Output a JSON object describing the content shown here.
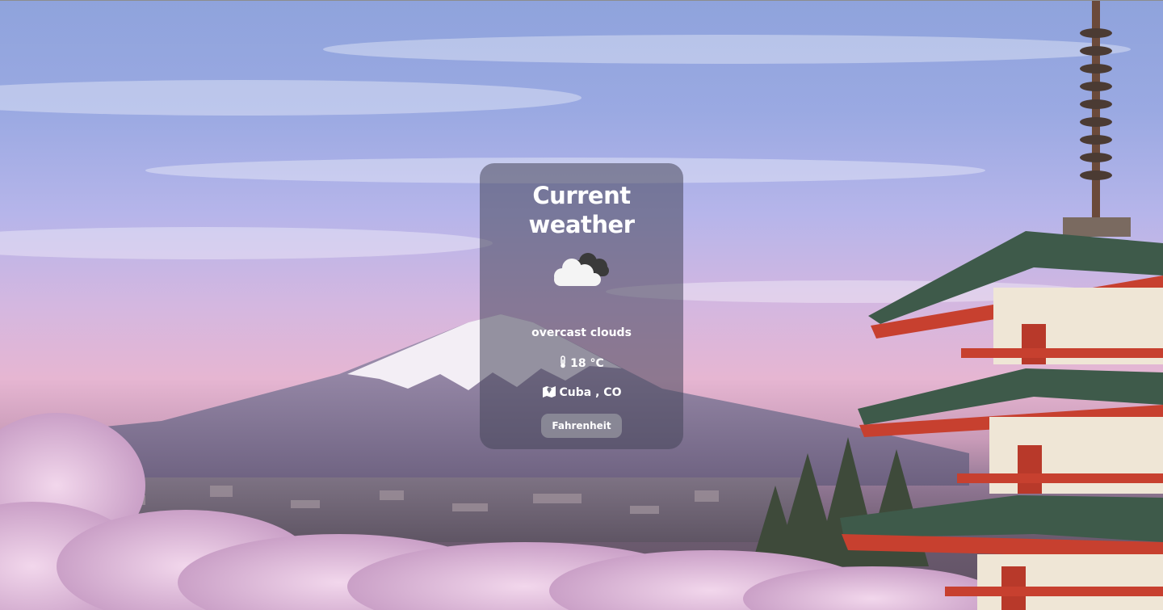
{
  "weather": {
    "title": "Current weather",
    "icon": "cloud-icon",
    "description": "overcast clouds",
    "temperature": "18 °C",
    "location": "Cuba , CO",
    "unit_button_label": "Fahrenheit"
  },
  "colors": {
    "card_bg": "rgba(70,70,90,0.55)",
    "text": "#ffffff",
    "button_bg": "#9696a0"
  }
}
